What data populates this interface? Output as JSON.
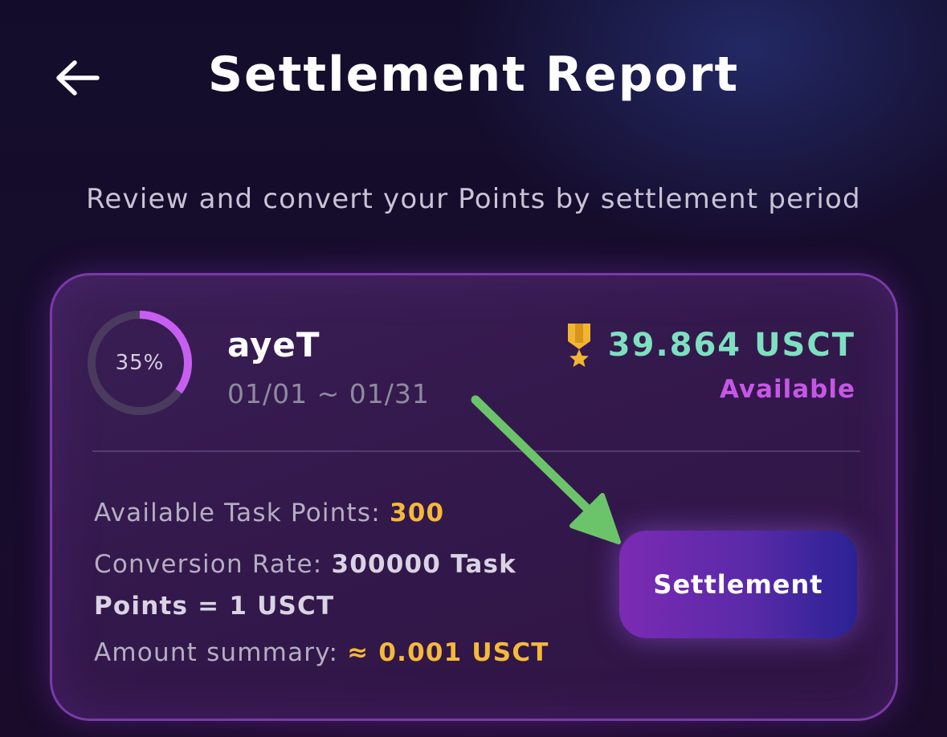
{
  "header": {
    "title": "Settlement Report",
    "back_icon": "arrow-left-icon"
  },
  "subtitle": "Review and convert your Points by settlement period",
  "card": {
    "progress_percent": 35,
    "progress_label": "35%",
    "task_name": "ayeT",
    "period": "01/01 ~ 01/31",
    "medal_icon": "medal-icon",
    "amount": "39.864 USCT",
    "status": "Available",
    "available_points_label": "Available Task Points:",
    "available_points_value": "300",
    "conversion_rate_label": "Conversion Rate:",
    "conversion_rate_value": "300000 Task Points = 1 USCT",
    "amount_summary_label": "Amount summary:",
    "amount_summary_value": "≈ 0.001 USCT",
    "settlement_button": "Settlement"
  },
  "colors": {
    "accent_purple": "#c657e6",
    "amount_green": "#7ee0c0",
    "highlight_yellow": "#f5b93a",
    "annotation_arrow": "#6cc46a"
  }
}
